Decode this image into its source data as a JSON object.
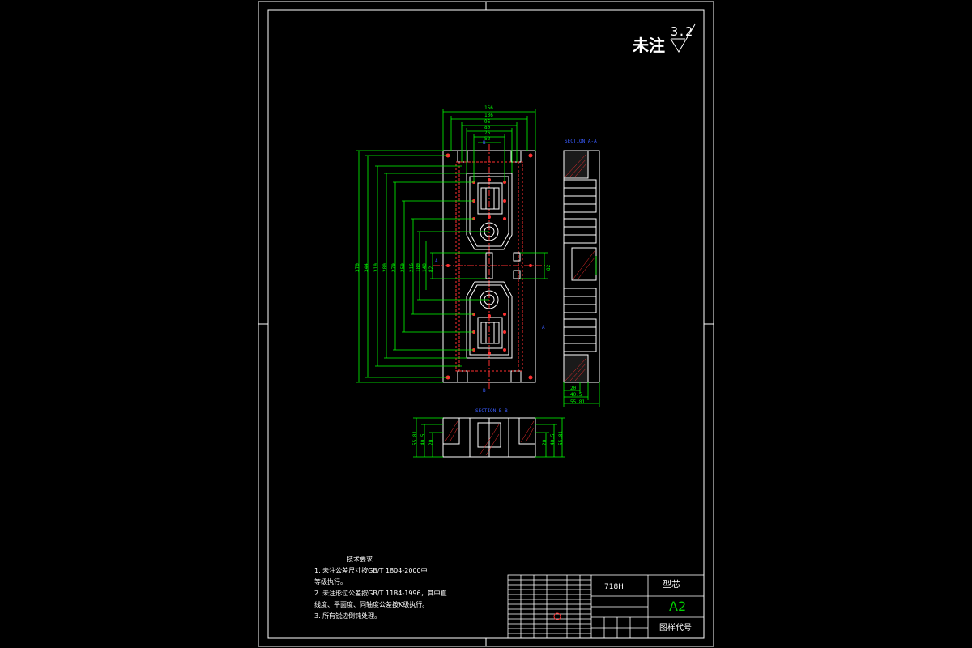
{
  "surface_roughness": {
    "label": "未注",
    "value": "3.2"
  },
  "sections": {
    "side": "SECTION A-A",
    "bottom": "SECTION B-B"
  },
  "technical_requirements": {
    "title": "技术要求",
    "items": [
      "1. 未注公差尺寸按GB/T 1804-2000中",
      "   等级执行。",
      "2. 未注形位公差按GB/T 1184-1996，其中直",
      "   线度、平面度、同轴度公差按K级执行。",
      "3. 所有锐边倒钝处理。"
    ]
  },
  "title_block": {
    "material": "718H",
    "part_name": "型芯",
    "scale": "A2",
    "drawing_number_label": "图样代号"
  },
  "dimensions": {
    "top_horizontal": [
      "156",
      "136",
      "96",
      "80",
      "76",
      "52"
    ],
    "left_vertical": [
      "370",
      "344",
      "310",
      "280",
      "270",
      "250",
      "216",
      "180",
      "140",
      "82"
    ],
    "center_right": "82",
    "side_bottom": [
      "20",
      "40.5",
      "55.81"
    ],
    "bottom_left": [
      "55.81",
      "40.5",
      "20"
    ],
    "bottom_right": [
      "55.81",
      "40.5",
      "20"
    ]
  },
  "colors": {
    "background": "#000000",
    "outline": "#ffffff",
    "dimension": "#00ff00",
    "hole_marker": "#ff3030",
    "section_label": "#3a5cff"
  }
}
